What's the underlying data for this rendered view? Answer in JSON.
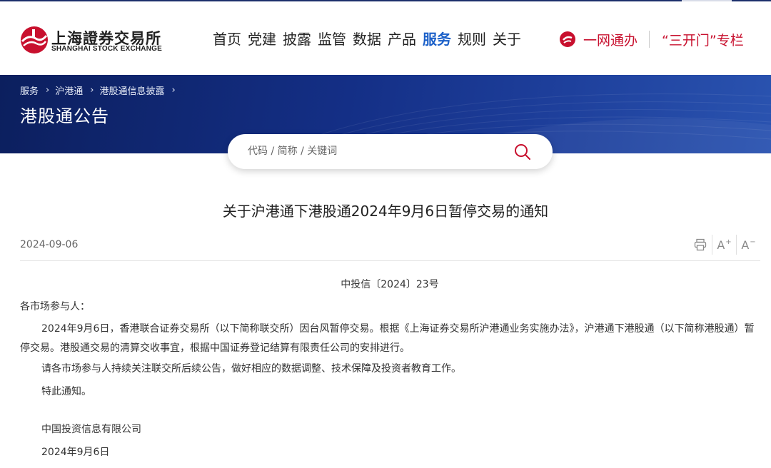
{
  "brand": {
    "name_cn": "上海證券交易所",
    "name_en": "SHANGHAI STOCK EXCHANGE",
    "color": "#c8102e"
  },
  "nav": {
    "items": [
      "首页",
      "党建",
      "披露",
      "监管",
      "数据",
      "产品",
      "服务",
      "规则",
      "关于"
    ],
    "active": "服务",
    "active_color": "#1a5fc8"
  },
  "quick_links": {
    "one_web": "一网通办",
    "column": "“三开门”专栏"
  },
  "breadcrumb": [
    "服务",
    "沪港通",
    "港股通信息披露"
  ],
  "banner": {
    "title": "港股通公告"
  },
  "search": {
    "placeholder": "代码 / 简称 / 关键词",
    "icon": "search-icon"
  },
  "article": {
    "title": "关于沪港通下港股通2024年9月6日暂停交易的通知",
    "date": "2024-09-06",
    "tools": [
      "print-icon",
      "font-increase-icon",
      "font-decrease-icon"
    ],
    "doc_number": "中投信〔2024〕23号",
    "salutation": "各市场参与人：",
    "paragraphs": [
      "2024年9月6日，香港联合证券交易所（以下简称联交所）因台风暂停交易。根据《上海证券交易所沪港通业务实施办法》，沪港通下港股通（以下简称港股通）暂停交易。港股通交易的清算交收事宜，根据中国证券登记结算有限责任公司的安排进行。",
      "请各市场参与人持续关注联交所后续公告，做好相应的数据调整、技术保障及投资者教育工作。",
      "特此通知。"
    ],
    "signature": "中国投资信息有限公司",
    "signature_date": "2024年9月6日"
  }
}
